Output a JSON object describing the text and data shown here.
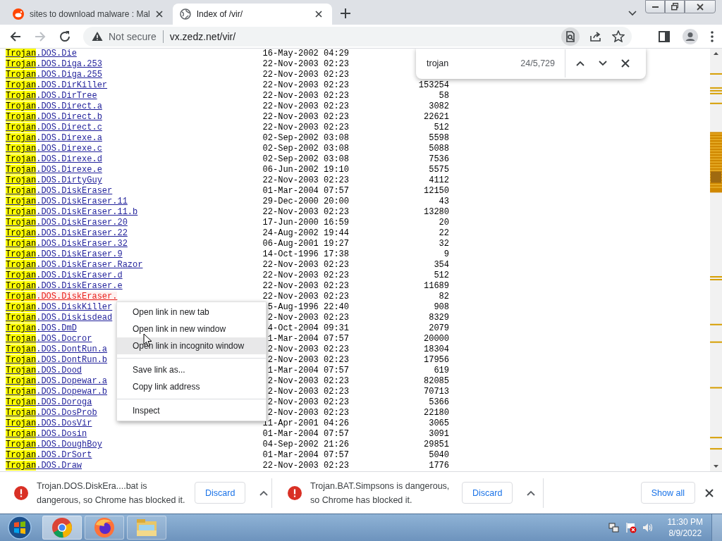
{
  "browser": {
    "tabs": [
      {
        "title": "sites to download malware : Mal",
        "selected": false
      },
      {
        "title": "Index of /vir/",
        "selected": true
      }
    ],
    "toolbar": {
      "security": "Not secure",
      "url": "vx.zedz.net/vir/",
      "forward_disabled": true
    }
  },
  "find_bar": {
    "query": "trojan",
    "count": "24/5,729"
  },
  "listing": {
    "rows": [
      {
        "match": "Trojan",
        "rest": ".DOS.Die",
        "date": "16-May-2002 04:29",
        "active": false
      },
      {
        "match": "Trojan",
        "rest": ".DOS.Diga.253",
        "date": "22-Nov-2003 02:23",
        "active": false
      },
      {
        "match": "Trojan",
        "rest": ".DOS.Diga.255",
        "date": "22-Nov-2003 02:23",
        "active": false
      },
      {
        "match": "Trojan",
        "rest": ".DOS.DirKiller",
        "date": "22-Nov-2003 02:23",
        "size": "153254",
        "active": false
      },
      {
        "match": "Trojan",
        "rest": ".DOS.DirTree",
        "date": "22-Nov-2003 02:23",
        "size": "58",
        "active": false
      },
      {
        "match": "Trojan",
        "rest": ".DOS.Direct.a",
        "date": "22-Nov-2003 02:23",
        "size": "3082",
        "active": false
      },
      {
        "match": "Trojan",
        "rest": ".DOS.Direct.b",
        "date": "22-Nov-2003 02:23",
        "size": "22621",
        "active": false
      },
      {
        "match": "Trojan",
        "rest": ".DOS.Direct.c",
        "date": "22-Nov-2003 02:23",
        "size": "512",
        "active": false
      },
      {
        "match": "Trojan",
        "rest": ".DOS.Direxe.a",
        "date": "02-Sep-2002 03:08",
        "size": "5598",
        "active": false
      },
      {
        "match": "Trojan",
        "rest": ".DOS.Direxe.c",
        "date": "02-Sep-2002 03:08",
        "size": "5088",
        "active": false
      },
      {
        "match": "Trojan",
        "rest": ".DOS.Direxe.d",
        "date": "02-Sep-2002 03:08",
        "size": "7536",
        "active": false
      },
      {
        "match": "Trojan",
        "rest": ".DOS.Direxe.e",
        "date": "06-Jun-2002 19:10",
        "size": "5575",
        "active": false
      },
      {
        "match": "Trojan",
        "rest": ".DOS.DirtyGuy",
        "date": "22-Nov-2003 02:23",
        "size": "4112",
        "active": false
      },
      {
        "match": "Trojan",
        "rest": ".DOS.DiskEraser",
        "date": "01-Mar-2004 07:57",
        "size": "12150",
        "active": false
      },
      {
        "match": "Trojan",
        "rest": ".DOS.DiskEraser.11",
        "date": "29-Dec-2000 20:00",
        "size": "43",
        "active": false
      },
      {
        "match": "Trojan",
        "rest": ".DOS.DiskEraser.11.b",
        "date": "22-Nov-2003 02:23",
        "size": "13280",
        "active": false
      },
      {
        "match": "Trojan",
        "rest": ".DOS.DiskEraser.20",
        "date": "17-Jun-2000 16:59",
        "size": "20",
        "active": false
      },
      {
        "match": "Trojan",
        "rest": ".DOS.DiskEraser.22",
        "date": "24-Aug-2002 19:44",
        "size": "22",
        "active": false
      },
      {
        "match": "Trojan",
        "rest": ".DOS.DiskEraser.32",
        "date": "06-Aug-2001 19:27",
        "size": "32",
        "active": false
      },
      {
        "match": "Trojan",
        "rest": ".DOS.DiskEraser.9",
        "date": "14-Oct-1996 17:38",
        "size": "9",
        "active": false
      },
      {
        "match": "Trojan",
        "rest": ".DOS.DiskEraser.Razor",
        "date": "22-Nov-2003 02:23",
        "size": "354",
        "active": false
      },
      {
        "match": "Trojan",
        "rest": ".DOS.DiskEraser.d",
        "date": "22-Nov-2003 02:23",
        "size": "512",
        "active": false
      },
      {
        "match": "Trojan",
        "rest": ".DOS.DiskEraser.e",
        "date": "22-Nov-2003 02:23",
        "size": "11689",
        "active": false
      },
      {
        "match": "Trojan",
        "rest": ".DOS.DiskEraser.",
        "date": "22-Nov-2003 02:23",
        "size": "82",
        "active": true
      },
      {
        "match": "Trojan",
        "rest": ".DOS.DiskKiller",
        "date": "5-Aug-1996 22:40",
        "size": "908",
        "active": false
      },
      {
        "match": "Trojan",
        "rest": ".DOS.Diskisdead",
        "date": "2-Nov-2003 02:23",
        "size": "8329",
        "active": false
      },
      {
        "match": "Trojan",
        "rest": ".DOS.DmD",
        "date": "4-Oct-2004 09:31",
        "size": "2079",
        "active": false
      },
      {
        "match": "Trojan",
        "rest": ".DOS.Docror",
        "date": "1-Mar-2004 07:57",
        "size": "20000",
        "active": false
      },
      {
        "match": "Trojan",
        "rest": ".DOS.DontRun.a",
        "date": "2-Nov-2003 02:23",
        "size": "18304",
        "active": false
      },
      {
        "match": "Trojan",
        "rest": ".DOS.DontRun.b",
        "date": "2-Nov-2003 02:23",
        "size": "17956",
        "active": false
      },
      {
        "match": "Trojan",
        "rest": ".DOS.Dood",
        "date": "1-Mar-2004 07:57",
        "size": "619",
        "active": false
      },
      {
        "match": "Trojan",
        "rest": ".DOS.Dopewar.a",
        "date": "2-Nov-2003 02:23",
        "size": "82085",
        "active": false
      },
      {
        "match": "Trojan",
        "rest": ".DOS.Dopewar.b",
        "date": "2-Nov-2003 02:23",
        "size": "70713",
        "active": false
      },
      {
        "match": "Trojan",
        "rest": ".DOS.Doroga",
        "date": "2-Nov-2003 02:23",
        "size": "5366",
        "active": false
      },
      {
        "match": "Trojan",
        "rest": ".DOS.DosProb",
        "date": "2-Nov-2003 02:23",
        "size": "22180",
        "active": false
      },
      {
        "match": "Trojan",
        "rest": ".DOS.DosVir",
        "date": "11-Apr-2001 04:26",
        "size": "3065",
        "active": false
      },
      {
        "match": "Trojan",
        "rest": ".DOS.Dosin",
        "date": "01-Mar-2004 07:57",
        "size": "3091",
        "active": false
      },
      {
        "match": "Trojan",
        "rest": ".DOS.DoughBoy",
        "date": "04-Sep-2002 21:26",
        "size": "29851",
        "active": false
      },
      {
        "match": "Trojan",
        "rest": ".DOS.DrSort",
        "date": "01-Mar-2004 07:57",
        "size": "5040",
        "active": false
      },
      {
        "match": "Trojan",
        "rest": ".DOS.Draw",
        "date": "22-Nov-2003 02:23",
        "size": "1776",
        "active": false
      }
    ]
  },
  "context_menu": {
    "items": [
      {
        "kind": "item",
        "label": "Open link in new tab",
        "selected": false
      },
      {
        "kind": "item",
        "label": "Open link in new window",
        "selected": false
      },
      {
        "kind": "item",
        "label": "Open link in incognito window",
        "selected": true
      },
      {
        "kind": "separator"
      },
      {
        "kind": "item",
        "label": "Save link as...",
        "selected": false
      },
      {
        "kind": "item",
        "label": "Copy link address",
        "selected": false
      },
      {
        "kind": "separator"
      },
      {
        "kind": "item",
        "label": "Inspect",
        "selected": false
      }
    ]
  },
  "downloads": {
    "items": [
      {
        "text": "Trojan.DOS.DiskEra....bat is dangerous, so Chrome has blocked it.",
        "button": "Discard"
      },
      {
        "text": "Trojan.BAT.Simpsons is dangerous, so Chrome has blocked it.",
        "button": "Discard"
      }
    ],
    "show_all": "Show all"
  },
  "taskbar": {
    "apps": [
      {
        "kind": "chrome",
        "selected": true
      },
      {
        "kind": "firefox",
        "selected": false
      },
      {
        "kind": "explorer",
        "selected": false
      }
    ],
    "time": "11:30 PM",
    "date": "8/9/2022"
  }
}
